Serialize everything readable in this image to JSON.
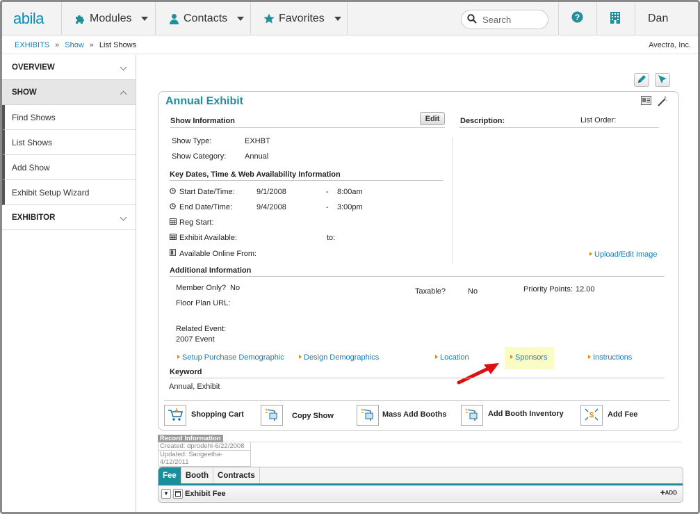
{
  "nav": {
    "logo": "abila",
    "modules": "Modules",
    "contacts": "Contacts",
    "favorites": "Favorites",
    "search_placeholder": "Search",
    "user": "Dan"
  },
  "breadcrumb": {
    "items": [
      "EXHIBITS",
      "Show",
      "List Shows"
    ],
    "separator": "»",
    "company": "Avectra, Inc."
  },
  "sidebar": {
    "overview": "OVERVIEW",
    "show": "SHOW",
    "items": [
      "Find Shows",
      "List Shows",
      "Add Show",
      "Exhibit Setup Wizard"
    ],
    "exhibitor": "EXHIBITOR"
  },
  "panel": {
    "title": "Annual Exhibit",
    "show_info_header": "Show Information",
    "edit_label": "Edit",
    "description_label": "Description:",
    "list_order_label": "List Order:",
    "show_type_label": "Show Type:",
    "show_type_value": "EXHBT",
    "show_category_label": "Show Category:",
    "show_category_value": "Annual",
    "dates_header": "Key Dates, Time & Web Availability Information",
    "start_label": "Start Date/Time:",
    "start_date": "9/1/2008",
    "start_time": "8:00am",
    "end_label": "End Date/Time:",
    "end_date": "9/4/2008",
    "end_time": "3:00pm",
    "dash": "-",
    "reg_start_label": "Reg Start:",
    "exhibit_available_label": "Exhibit Available:",
    "to_label": "to:",
    "available_online_label": "Available Online From:",
    "upload_link": "Upload/Edit Image",
    "additional_header": "Additional Information",
    "member_only_label": "Member Only?",
    "member_only_value": "No",
    "taxable_label": "Taxable?",
    "taxable_value": "No",
    "priority_label": "Priority Points:",
    "priority_value": "12.00",
    "floor_plan_label": "Floor Plan URL:",
    "related_event_label": "Related Event:",
    "related_event_value": "2007 Event",
    "links": [
      "Setup Purchase Demographic",
      "Design Demographics",
      "Location",
      "Sponsors",
      "Instructions"
    ],
    "keyword_header": "Keyword",
    "keyword_value": "Annual, Exhibit",
    "toolbar": [
      "Shopping Cart",
      "Copy Show",
      "Mass Add Booths",
      "Add Booth Inventory",
      "Add Fee"
    ]
  },
  "record": {
    "header": "Record Information",
    "created": "Created: dprodehl-6/22/2008",
    "updated": "Updated: Sangeetha-4/12/2011"
  },
  "tabs": {
    "items": [
      "Fee",
      "Booth",
      "Contracts"
    ],
    "active": "Fee",
    "row_label": "Exhibit Fee",
    "add_label": "ADD"
  },
  "colors": {
    "accent": "#1a8f9b",
    "link": "#1a7bb5",
    "highlight": "#fafcc6",
    "arrow": "#e01010"
  }
}
